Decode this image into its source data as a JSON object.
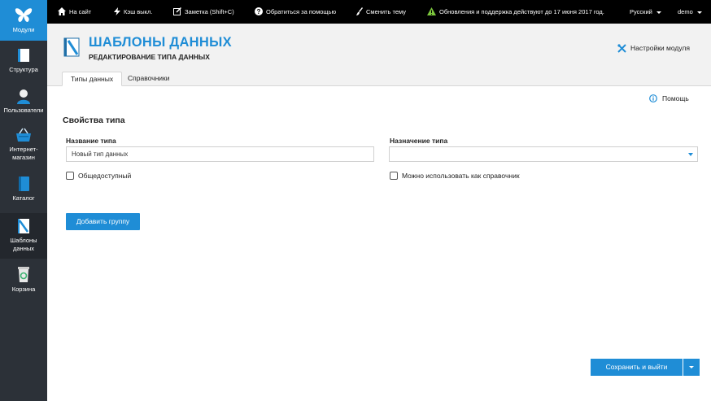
{
  "sidebar": {
    "items": [
      {
        "label": "Модули",
        "icon": "butterfly-icon"
      },
      {
        "label": "Структура",
        "icon": "structure-icon"
      },
      {
        "label": "Пользователи",
        "icon": "user-icon"
      },
      {
        "label": "Интернет-магазин",
        "label_lines": [
          "Интернет-",
          "магазин"
        ],
        "icon": "basket-icon"
      },
      {
        "label": "Каталог",
        "icon": "catalog-book-icon"
      },
      {
        "label": "Шаблоны данных",
        "label_lines": [
          "Шаблоны",
          "данных"
        ],
        "icon": "data-templates-icon"
      },
      {
        "label": "Корзина",
        "icon": "recycle-bin-icon"
      }
    ]
  },
  "topbar": {
    "to_site": "На сайт",
    "cache": "Кэш выкл.",
    "note": "Заметка (Shift+C)",
    "support": "Обратиться за помощью",
    "theme": "Сменить тему",
    "updates": "Обновления и поддержка действуют до 17 июня 2017 год.",
    "language": "Русский",
    "user": "demo"
  },
  "header": {
    "title": "ШАБЛОНЫ ДАННЫХ",
    "subtitle": "РЕДАКТИРОВАНИЕ ТИПА ДАННЫХ",
    "module_settings": "Настройки модуля",
    "tabs": [
      "Типы данных",
      "Справочники"
    ]
  },
  "content": {
    "help": "Помощь",
    "section_title": "Свойства типа",
    "name_label": "Название типа",
    "name_value": "Новый тип данных",
    "purpose_label": "Назначение типа",
    "purpose_value": "",
    "public_checkbox": "Общедоступный",
    "reference_checkbox": "Можно использовать как справочник",
    "add_group": "Добавить группу",
    "save_exit": "Сохранить и выйти"
  },
  "colors": {
    "accent": "#1f8dd6",
    "sidebar_bg": "#2c3138",
    "topbar_bg": "#000000",
    "updates_icon": "#7cc63d"
  }
}
